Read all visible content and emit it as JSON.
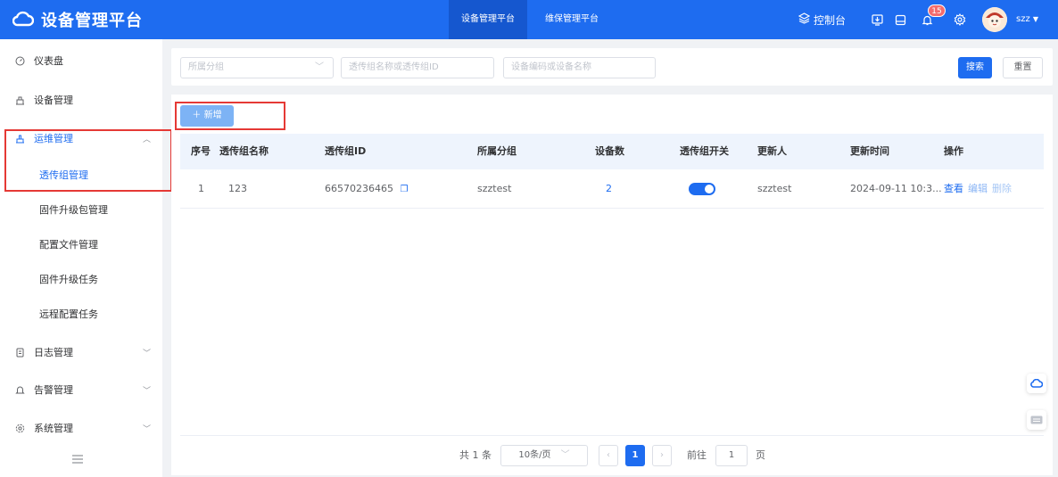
{
  "header": {
    "app_title": "设备管理平台",
    "nav_tabs": [
      "设备管理平台",
      "维保管理平台"
    ],
    "console_label": "控制台",
    "notification_count": "15",
    "user_name": "szz"
  },
  "sidebar": {
    "items": [
      {
        "label": "仪表盘",
        "icon": "dashboard-icon"
      },
      {
        "label": "设备管理",
        "icon": "device-icon"
      },
      {
        "label": "运维管理",
        "icon": "ops-icon"
      },
      {
        "label": "日志管理",
        "icon": "log-icon"
      },
      {
        "label": "告警管理",
        "icon": "bell-icon"
      },
      {
        "label": "系统管理",
        "icon": "gear-icon"
      }
    ],
    "sub_items": [
      "透传组管理",
      "固件升级包管理",
      "配置文件管理",
      "固件升级任务",
      "远程配置任务"
    ]
  },
  "search": {
    "group_placeholder": "所属分组",
    "name_placeholder": "透传组名称或透传组ID",
    "device_placeholder": "设备编码或设备名称",
    "search_label": "搜索",
    "reset_label": "重置"
  },
  "toolbar": {
    "add_label": "新增"
  },
  "table": {
    "columns": [
      "序号",
      "透传组名称",
      "透传组ID",
      "所属分组",
      "设备数",
      "透传组开关",
      "更新人",
      "更新时间",
      "操作"
    ],
    "rows": [
      {
        "index": "1",
        "name": "123",
        "id": "66570236465",
        "group": "szztest",
        "device_count": "2",
        "switch_on": true,
        "updater": "szztest",
        "updated_at": "2024-09-11 10:3..."
      }
    ],
    "actions": [
      "查看",
      "编辑",
      "删除"
    ]
  },
  "pagination": {
    "total": "共 1 条",
    "page_size": "10条/页",
    "current_page": "1",
    "goto_label": "前往",
    "goto_value": "1",
    "page_suffix": "页"
  },
  "colors": {
    "primary": "#1e6cf0",
    "highlight": "#e53935"
  }
}
